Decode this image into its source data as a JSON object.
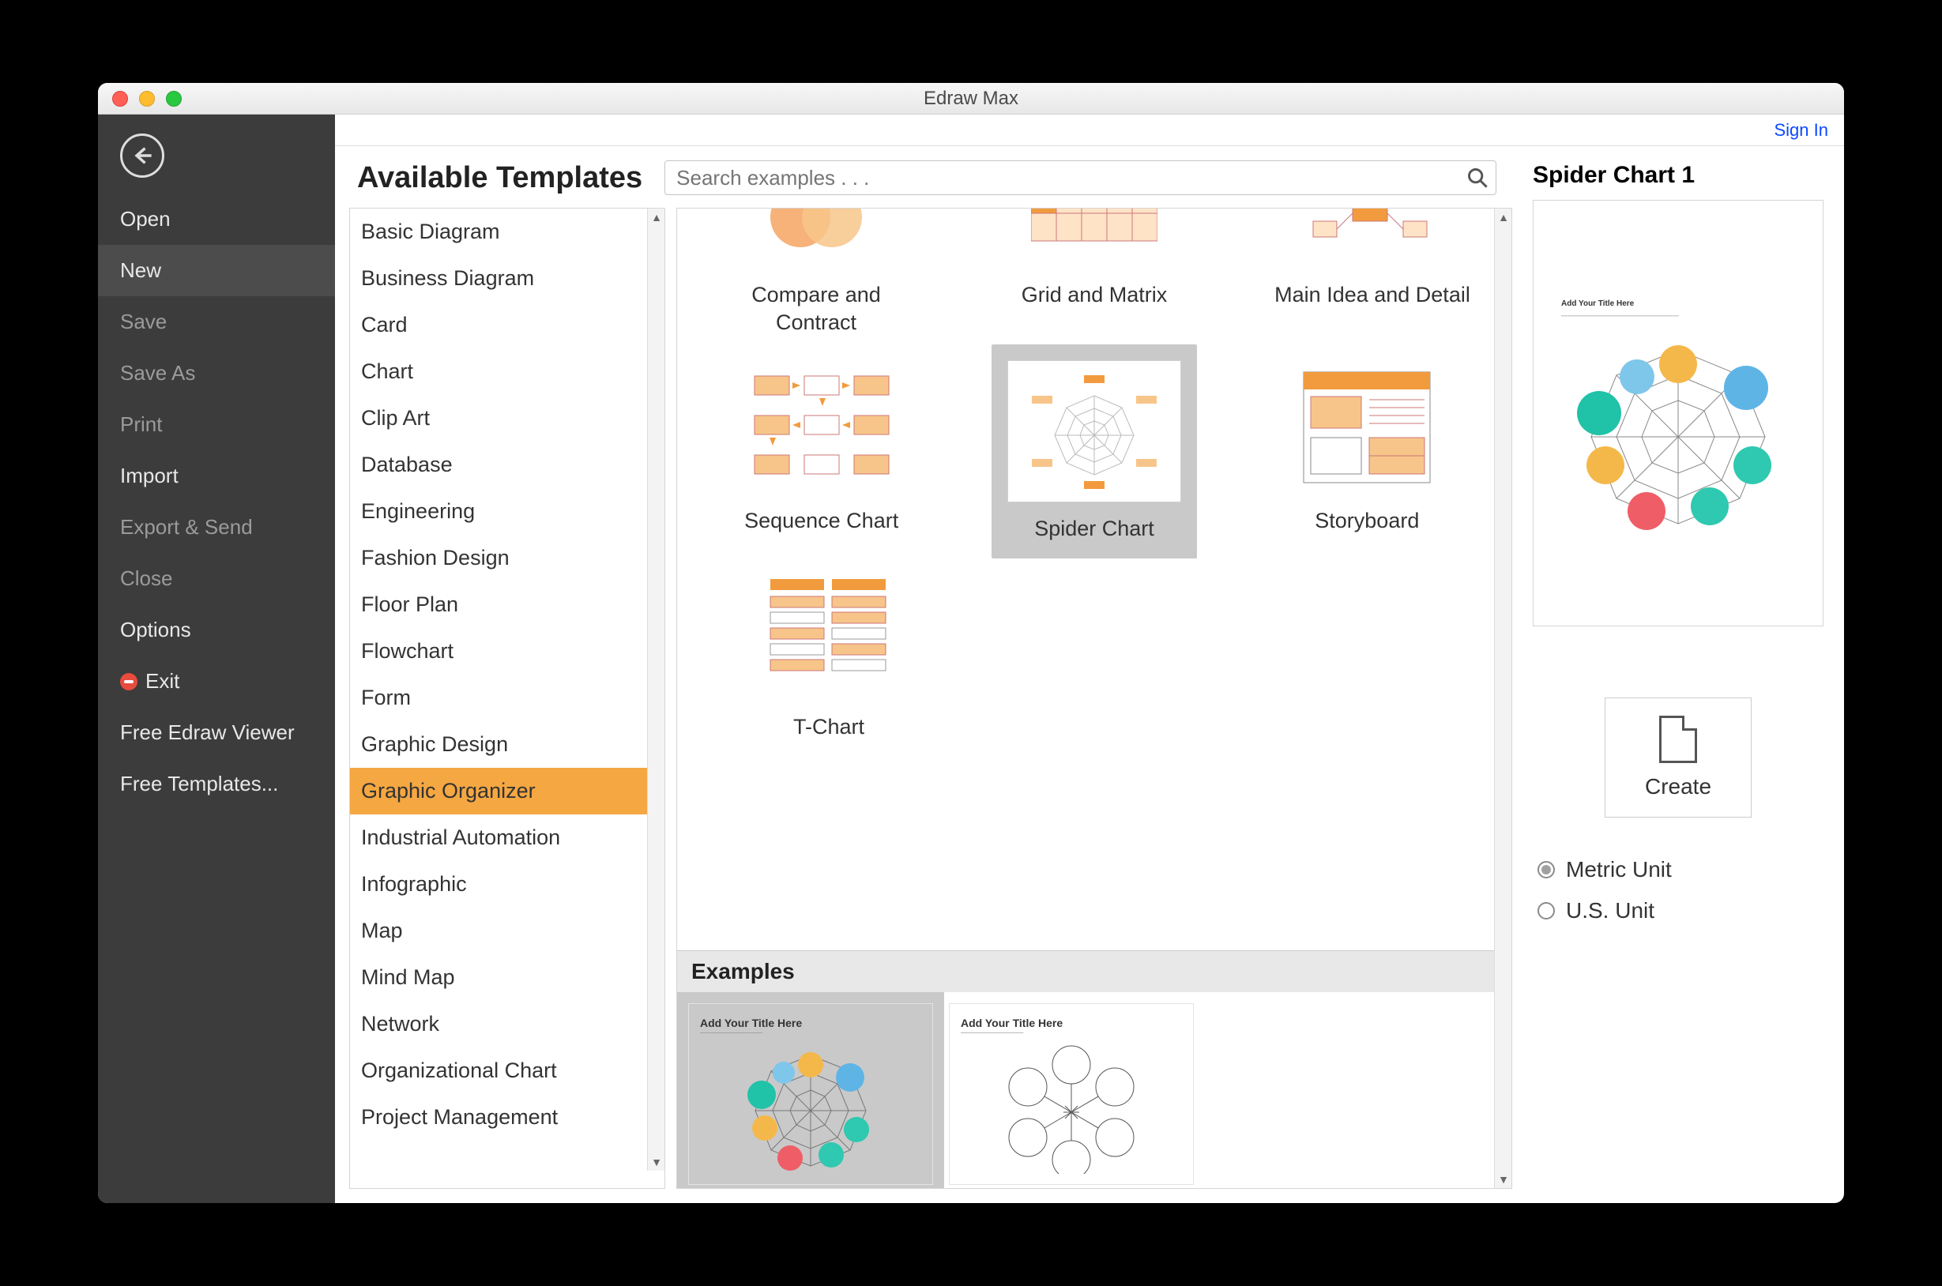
{
  "window_title": "Edraw Max",
  "signin": "Sign In",
  "sidebar": {
    "items": [
      {
        "label": "Open",
        "dim": false,
        "active": false
      },
      {
        "label": "New",
        "dim": false,
        "active": true
      },
      {
        "label": "Save",
        "dim": true,
        "active": false
      },
      {
        "label": "Save As",
        "dim": true,
        "active": false
      },
      {
        "label": "Print",
        "dim": true,
        "active": false
      },
      {
        "label": "Import",
        "dim": false,
        "active": false
      },
      {
        "label": "Export & Send",
        "dim": true,
        "active": false
      },
      {
        "label": "Close",
        "dim": true,
        "active": false
      },
      {
        "label": "Options",
        "dim": false,
        "active": false
      },
      {
        "label": "Exit",
        "dim": false,
        "active": false,
        "icon": "exit"
      },
      {
        "label": "Free Edraw Viewer",
        "dim": false,
        "active": false
      },
      {
        "label": "Free Templates...",
        "dim": false,
        "active": false
      }
    ]
  },
  "page_title": "Available Templates",
  "search_placeholder": "Search examples . . .",
  "categories": [
    "Basic Diagram",
    "Business Diagram",
    "Card",
    "Chart",
    "Clip Art",
    "Database",
    "Engineering",
    "Fashion Design",
    "Floor Plan",
    "Flowchart",
    "Form",
    "Graphic Design",
    "Graphic Organizer",
    "Industrial Automation",
    "Infographic",
    "Map",
    "Mind Map",
    "Network",
    "Organizational Chart",
    "Project Management"
  ],
  "selected_category": "Graphic Organizer",
  "templates": {
    "row1": [
      {
        "label": "Compare and Contract"
      },
      {
        "label": "Grid and Matrix"
      },
      {
        "label": "Main Idea and Detail"
      }
    ],
    "row2": [
      {
        "label": "Sequence Chart"
      },
      {
        "label": "Spider Chart",
        "selected": true
      },
      {
        "label": "Storyboard"
      }
    ],
    "row3": [
      {
        "label": "T-Chart"
      }
    ]
  },
  "examples_header": "Examples",
  "examples": [
    {
      "title": "Add Your Title Here",
      "selected": true,
      "kind": "color-spider"
    },
    {
      "title": "Add Your Title Here",
      "selected": false,
      "kind": "bw-spider"
    }
  ],
  "preview": {
    "title": "Spider Chart 1",
    "thumb_title": "Add Your Title Here",
    "create_label": "Create",
    "units": [
      {
        "label": "Metric Unit",
        "checked": true
      },
      {
        "label": "U.S. Unit",
        "checked": false
      }
    ]
  }
}
